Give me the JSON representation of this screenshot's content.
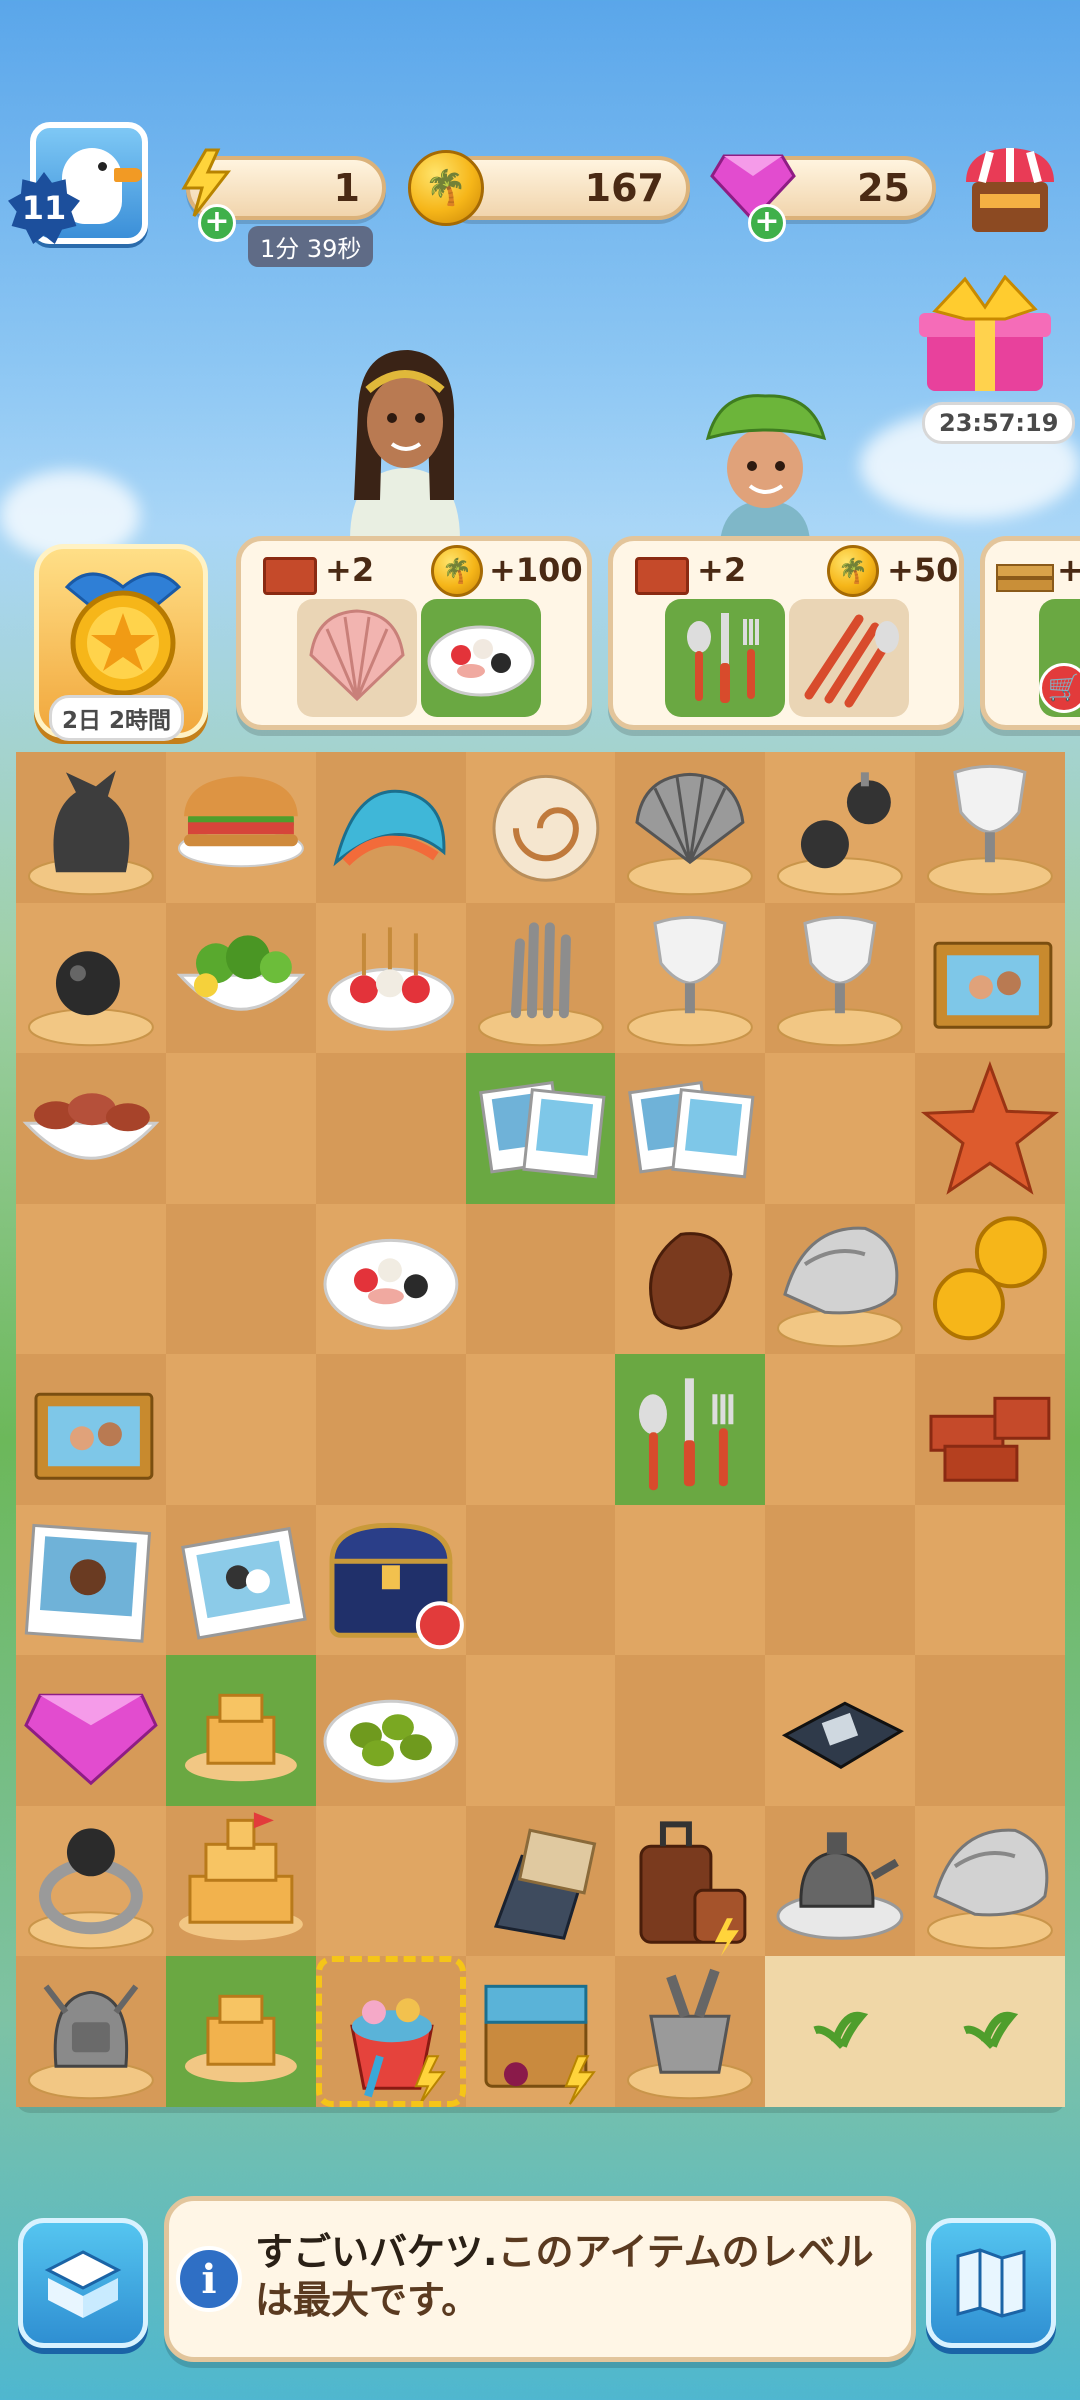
{
  "top_bar": {
    "player_level": "11",
    "energy": {
      "value": "1",
      "refill_timer": "1分 39秒",
      "icon": "lightning-icon"
    },
    "coins": {
      "value": "167",
      "icon": "palm-coin-icon"
    },
    "gems": {
      "value": "25",
      "icon": "gem-icon"
    },
    "shop_icon": "market-stall-icon"
  },
  "event": {
    "timer": "23:57:19",
    "icon": "gift-box-icon"
  },
  "medal": {
    "timer": "2日 2時間",
    "icon": "star-medal-icon"
  },
  "orders": [
    {
      "reward_bricks": "+2",
      "reward_coins": "+100",
      "items": [
        "seashell",
        "salad-plate"
      ],
      "completed_slots": [
        1
      ]
    },
    {
      "reward_bricks": "+2",
      "reward_coins": "+50",
      "items": [
        "cutlery",
        "cutlery-set"
      ],
      "completed_slots": [
        0
      ]
    },
    {
      "reward_bricks": "+",
      "items": [
        "partial"
      ],
      "completed_slots": [
        0
      ]
    }
  ],
  "board": {
    "rows": 9,
    "cols": 7,
    "items": [
      [
        "sack-on-sand",
        "sandwich",
        "coral-shell",
        "nautilus-shell",
        "clam-shell",
        "bombs",
        "bust"
      ],
      [
        "bomb",
        "salad-bowl",
        "caprese-skewers",
        "glove-stand",
        "bust",
        "bust",
        "photo-frame"
      ],
      [
        "bacon-bowl",
        "",
        "",
        "photos",
        "photos",
        "",
        "starfish"
      ],
      [
        "",
        "",
        "salad-plate",
        "",
        "pebble",
        "conch",
        "coins"
      ],
      [
        "photo-frame",
        "",
        "",
        "",
        "cutlery",
        "",
        "bricks"
      ],
      [
        "photo",
        "wedding-photo",
        "chest",
        "",
        "",
        "",
        "brick-stairs"
      ],
      [
        "gem",
        "sandcastle-small",
        "olives",
        "",
        "",
        "camera-box",
        ""
      ],
      [
        "ring",
        "sandcastle",
        "",
        "photo-album",
        "luggage",
        "teapot-set",
        "conch"
      ],
      [
        "backpack",
        "sandcastle-small",
        "beach-bucket",
        "picnic-basket",
        "metal-bucket",
        "sand",
        "sand"
      ]
    ],
    "green_cells": [
      [
        2,
        3
      ],
      [
        4,
        4
      ],
      [
        6,
        1
      ],
      [
        8,
        1
      ]
    ],
    "selected_cell": [
      8,
      2
    ]
  },
  "bottom": {
    "inventory_icon": "box-icon",
    "info_icon": "info-icon",
    "info_title": "すごいバケツ.",
    "info_text": "このアイテムのレベルは最大です。",
    "map_icon": "map-icon"
  }
}
